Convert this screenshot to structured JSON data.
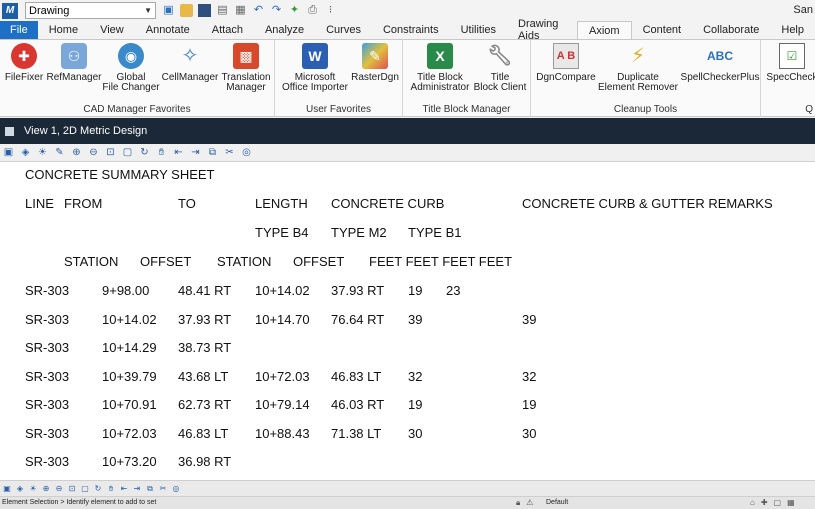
{
  "qat": {
    "workspace_value": "Drawing",
    "user_name": "San",
    "icons": [
      "view-toggle-icon",
      "open-folder-icon",
      "save-icon",
      "save-all-icon",
      "print-preview-icon",
      "undo-icon",
      "redo-icon",
      "pin-icon",
      "print-icon",
      "customize-icon"
    ]
  },
  "tabs": [
    {
      "label": "File",
      "state": "file"
    },
    {
      "label": "Home"
    },
    {
      "label": "View"
    },
    {
      "label": "Annotate"
    },
    {
      "label": "Attach"
    },
    {
      "label": "Analyze"
    },
    {
      "label": "Curves"
    },
    {
      "label": "Constraints"
    },
    {
      "label": "Utilities"
    },
    {
      "label": "Drawing Aids"
    },
    {
      "label": "Axiom",
      "state": "active"
    },
    {
      "label": "Content"
    },
    {
      "label": "Collaborate"
    },
    {
      "label": "Help"
    }
  ],
  "ribbon": {
    "groups": [
      {
        "label": "CAD Manager Favorites"
      },
      {
        "label": "User Favorites"
      },
      {
        "label": "Title Block Manager"
      },
      {
        "label": "Cleanup Tools"
      },
      {
        "label": "Q"
      }
    ],
    "buttons": {
      "filefixer": "FileFixer",
      "refmanager": "RefManager",
      "global_changer_1": "Global",
      "global_changer_2": "File Changer",
      "cellmanager": "CellManager",
      "translation_1": "Translation",
      "translation_2": "Manager",
      "office_1": "Microsoft",
      "office_2": "Office Importer",
      "rasterdgn": "RasterDgn",
      "tb_admin_1": "Title Block",
      "tb_admin_2": "Administrator",
      "tb_client_1": "Title",
      "tb_client_2": "Block Client",
      "dgncompare": "DgnCompare",
      "dup_1": "Duplicate",
      "dup_2": "Element Remover",
      "spell": "SpellCheckerPlus",
      "spec": "SpecCheck",
      "spell_icon_text": "ABC"
    }
  },
  "view": {
    "title": "View 1, 2D Metric Design"
  },
  "drawing": {
    "title": "CONCRETE SUMMARY SHEET",
    "header1": {
      "line": "LINE",
      "from": "FROM",
      "to": "TO",
      "length": "LENGTH",
      "curb": "CONCRETE CURB",
      "remarks": "CONCRETE CURB & GUTTER REMARKS"
    },
    "header2": {
      "b4": "TYPE B4",
      "m2": "TYPE M2",
      "b1": "TYPE B1"
    },
    "header3": {
      "station1": "STATION",
      "offset1": "OFFSET",
      "station2": "STATION",
      "offset2": "OFFSET",
      "feet": "FEET FEET FEET FEET"
    },
    "rows": [
      {
        "line": "SR-303",
        "from_sta": "9+98.00",
        "from_off": "48.41 RT",
        "to_sta": "10+14.02",
        "to_off": "37.93 RT",
        "f1": "19",
        "f2": "23",
        "f4": ""
      },
      {
        "line": "SR-303",
        "from_sta": "10+14.02",
        "from_off": "37.93 RT",
        "to_sta": "10+14.70",
        "to_off": "76.64 RT",
        "f1": "39",
        "f2": "",
        "f4": "39"
      },
      {
        "line": "SR-303",
        "from_sta": "10+14.29",
        "from_off": "38.73 RT",
        "to_sta": "",
        "to_off": "",
        "f1": "",
        "f2": "",
        "f4": ""
      },
      {
        "line": "SR-303",
        "from_sta": "10+39.79",
        "from_off": "43.68 LT",
        "to_sta": "10+72.03",
        "to_off": "46.83 LT",
        "f1": "32",
        "f2": "",
        "f4": "32"
      },
      {
        "line": "SR-303",
        "from_sta": "10+70.91",
        "from_off": "62.73 RT",
        "to_sta": "10+79.14",
        "to_off": "46.03 RT",
        "f1": "19",
        "f2": "",
        "f4": "19"
      },
      {
        "line": "SR-303",
        "from_sta": "10+72.03",
        "from_off": "46.83 LT",
        "to_sta": "10+88.43",
        "to_off": "71.38 LT",
        "f1": "30",
        "f2": "",
        "f4": "30"
      },
      {
        "line": "SR-303",
        "from_sta": "10+73.20",
        "from_off": "36.98 RT",
        "to_sta": "",
        "to_off": "",
        "f1": "",
        "f2": "",
        "f4": ""
      }
    ]
  },
  "status": {
    "prompt": "Element Selection > Identify element to add to set",
    "level": "Default"
  }
}
